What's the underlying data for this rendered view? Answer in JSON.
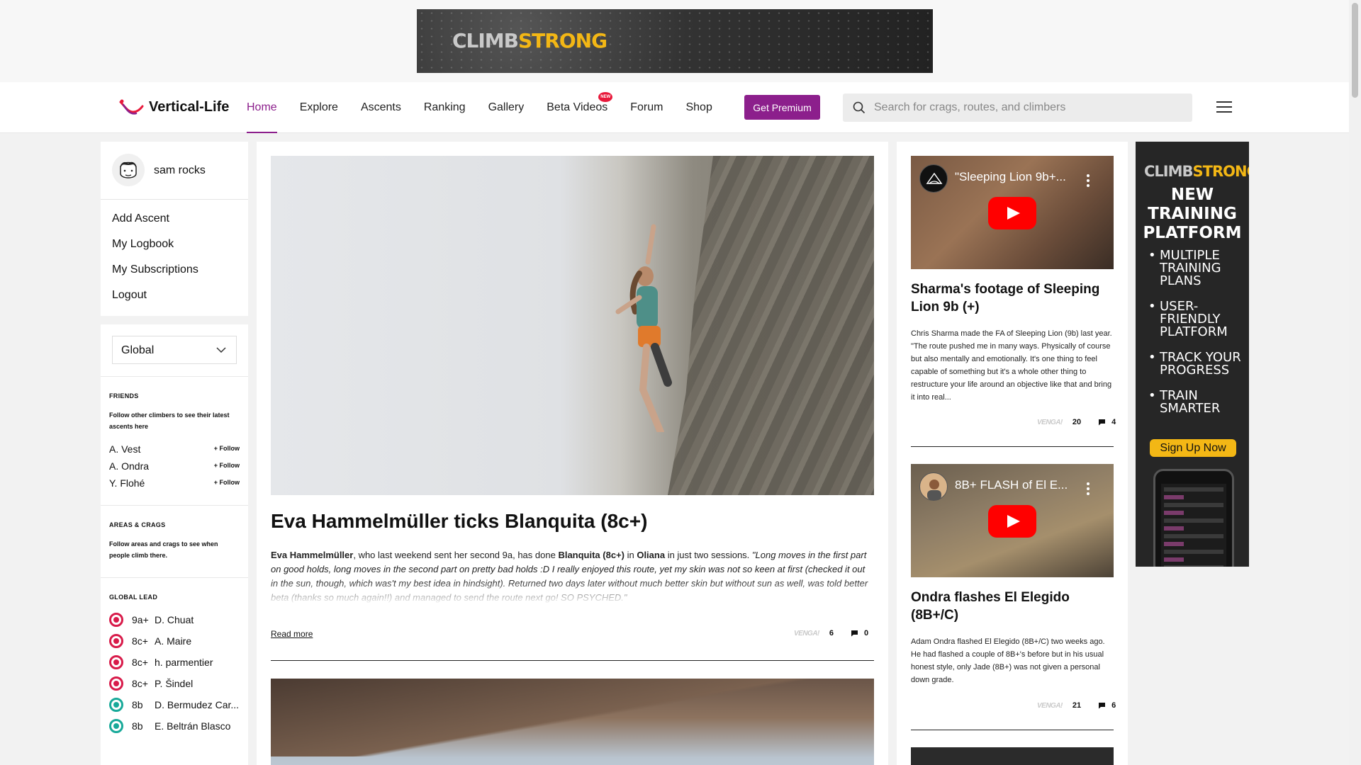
{
  "ads": {
    "top_banner": {
      "brand_part1": "CLIMB",
      "brand_part2": "STRONG"
    },
    "side": {
      "brand_part1": "CLIMB",
      "brand_part2": "STRONG",
      "headline": "NEW TRAINING PLATFORM",
      "bullets": [
        "MULTIPLE TRAINING PLANS",
        "USER-FRIENDLY PLATFORM",
        "TRACK YOUR PROGRESS",
        "TRAIN SMARTER"
      ],
      "cta": "Sign Up Now"
    }
  },
  "nav": {
    "brand": "Vertical-Life",
    "links": [
      "Home",
      "Explore",
      "Ascents",
      "Ranking",
      "Gallery",
      "Beta Videos",
      "Forum",
      "Shop"
    ],
    "active": "Home",
    "new_badge": "NEW",
    "premium": "Get Premium",
    "search_placeholder": "Search for crags, routes, and climbers"
  },
  "user": {
    "name": "sam rocks",
    "menu": [
      "Add Ascent",
      "My Logbook",
      "My Subscriptions",
      "Logout"
    ]
  },
  "sidebar": {
    "scope": "Global",
    "friends": {
      "title": "FRIENDS",
      "note": "Follow other climbers to see their latest ascents here",
      "people": [
        "A. Vest",
        "A. Ondra",
        "Y. Flohé"
      ],
      "follow_label": "+ Follow"
    },
    "areas": {
      "title": "AREAS & CRAGS",
      "note": "Follow areas and crags to see when people climb there."
    },
    "global_lead": {
      "title": "GLOBAL LEAD",
      "entries": [
        {
          "grade": "9a+",
          "name": "D. Chuat",
          "color": "#d81b4a"
        },
        {
          "grade": "8c+",
          "name": "A. Maire",
          "color": "#d81b4a"
        },
        {
          "grade": "8c+",
          "name": "h. parmentier",
          "color": "#d81b4a"
        },
        {
          "grade": "8c+",
          "name": "P. Šindel",
          "color": "#d81b4a"
        },
        {
          "grade": "8b",
          "name": "D. Bermudez Car...",
          "color": "#18a999"
        },
        {
          "grade": "8b",
          "name": "E. Beltrán Blasco",
          "color": "#18a999"
        }
      ]
    }
  },
  "main": {
    "article": {
      "title": "Eva Hammelmüller ticks Blanquita (8c+)",
      "body_parts": [
        {
          "t": "Eva Hammelmüller",
          "s": "b"
        },
        {
          "t": ", who last weekend sent her second 9a, has done ",
          "s": ""
        },
        {
          "t": "Blanquita (8c+)",
          "s": "b"
        },
        {
          "t": " in ",
          "s": ""
        },
        {
          "t": "Oliana",
          "s": "b"
        },
        {
          "t": " in just two sessions. ",
          "s": ""
        },
        {
          "t": "\"Long moves in the first part on good holds, long moves in the second part on pretty bad holds :D I really enjoyed this route, yet my skin was not so keen at first (checked it out in the sun, though, which was't my best idea in hindsight). Returned two days later without much better skin but without sun as well, was told better beta (thanks so much again!!) and managed to send the route next go! SO PSYCHED.\"",
          "s": "i"
        }
      ],
      "read_more": "Read more",
      "venga_label": "VENGA!",
      "venga_count": "6",
      "comments": "0"
    }
  },
  "news": [
    {
      "video_title": "\"Sleeping Lion 9b+...",
      "title": "Sharma's footage of Sleeping Lion 9b (+)",
      "body": "Chris Sharma made the FA of Sleeping Lion (9b) last year. \"The route pushed me in many ways. Physically of course but also mentally and emotionally. It's one thing to feel capable of something but it's a whole other thing to restructure your life around an objective like that and bring it into real...",
      "venga_label": "VENGA!",
      "venga_count": "20",
      "comments": "4"
    },
    {
      "video_title": "8B+ FLASH of El E...",
      "title": "Ondra flashes El Elegido (8B+/C)",
      "body": "Adam Ondra flashed El Elegido (8B+/C) two weeks ago. He had flashed a couple of 8B+'s before but in his usual honest style, only Jade (8B+) was not given a personal down grade.",
      "venga_label": "VENGA!",
      "venga_count": "21",
      "comments": "6"
    }
  ],
  "colors": {
    "accent": "#8c1f8c",
    "ad_yellow": "#f3b715",
    "youtube_red": "#ff0000"
  }
}
